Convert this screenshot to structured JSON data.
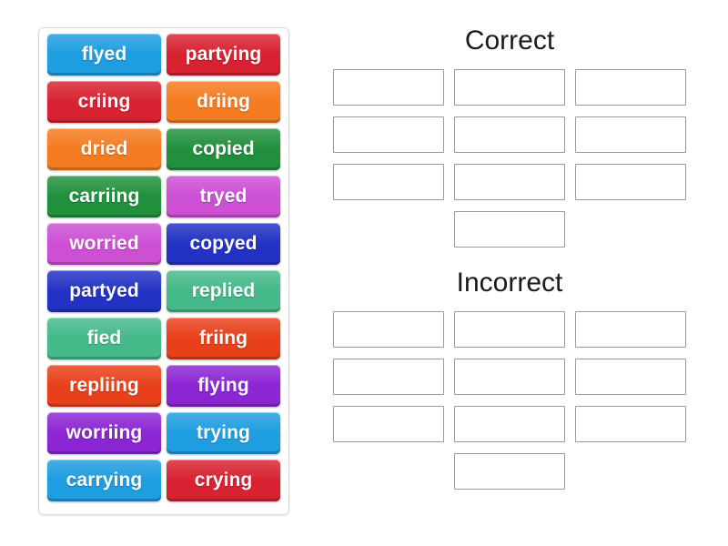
{
  "activity": {
    "type": "group-sort",
    "tile_text_color": "#ffffff",
    "tray_border_color": "#d8d8d8",
    "slot_border_color": "#9a9a9a",
    "heading_color": "#1a1a1a"
  },
  "tray": {
    "tiles": [
      {
        "label": "flyed",
        "color": "#1e9de0"
      },
      {
        "label": "partying",
        "color": "#d82231"
      },
      {
        "label": "criing",
        "color": "#d82231"
      },
      {
        "label": "driing",
        "color": "#f47b20"
      },
      {
        "label": "dried",
        "color": "#f47b20"
      },
      {
        "label": "copied",
        "color": "#21903c"
      },
      {
        "label": "carriing",
        "color": "#21903c"
      },
      {
        "label": "tryed",
        "color": "#cc4fd4"
      },
      {
        "label": "worried",
        "color": "#cc4fd4"
      },
      {
        "label": "copyed",
        "color": "#2232c4"
      },
      {
        "label": "partyed",
        "color": "#2232c4"
      },
      {
        "label": "replied",
        "color": "#45b98a"
      },
      {
        "label": "fied",
        "color": "#45b98a"
      },
      {
        "label": "friing",
        "color": "#e8401a"
      },
      {
        "label": "repliing",
        "color": "#e8401a"
      },
      {
        "label": "flying",
        "color": "#8c25d4"
      },
      {
        "label": "worriing",
        "color": "#8c25d4"
      },
      {
        "label": "trying",
        "color": "#1e9de0"
      },
      {
        "label": "carrying",
        "color": "#1e9de0"
      },
      {
        "label": "crying",
        "color": "#d82231"
      }
    ]
  },
  "zones": [
    {
      "title": "Correct",
      "slot_count": 10,
      "slots": [
        "",
        "",
        "",
        "",
        "",
        "",
        "",
        "",
        "",
        ""
      ]
    },
    {
      "title": "Incorrect",
      "slot_count": 10,
      "slots": [
        "",
        "",
        "",
        "",
        "",
        "",
        "",
        "",
        "",
        ""
      ]
    }
  ]
}
